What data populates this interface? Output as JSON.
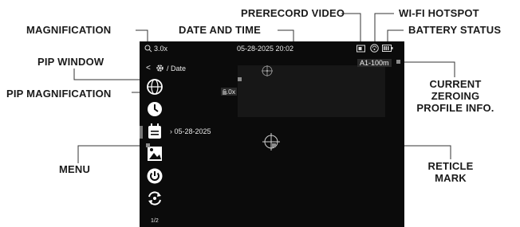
{
  "labels": {
    "magnification": "MAGNIFICATION",
    "date_and_time": "DATE AND TIME",
    "prerecord_video": "PRERECORD VIDEO",
    "wifi_hotspot": "WI-FI HOTSPOT",
    "battery_status": "BATTERY STATUS",
    "pip_window": "PIP WINDOW",
    "pip_magnification": "PIP MAGNIFICATION",
    "current_zeroing_line1": "CURRENT",
    "current_zeroing_line2": "ZEROING",
    "current_zeroing_line3": "PROFILE INFO.",
    "menu": "MENU",
    "reticle_line1": "RETICLE",
    "reticle_line2": "MARK"
  },
  "screen": {
    "magnification": "3.0x",
    "datetime": "05-28-2025 20:02",
    "breadcrumb": "/ Date",
    "pip_magnification": "6.0x",
    "zeroing_profile": "A1-100m",
    "date_value": "› 05-28-2025",
    "page_indicator": "1/2"
  },
  "icons": [
    "search-icon",
    "prerecord-video-icon",
    "wifi-hotspot-icon",
    "battery-icon",
    "back-chevron-icon",
    "gear-icon",
    "globe-icon",
    "clock-icon",
    "calendar-icon",
    "photo-icon",
    "power-icon",
    "rotate-icon",
    "reticle-icon"
  ],
  "colors": {
    "screen_bg": "#0b0b0b",
    "label_text": "#1a1a1a",
    "leader_line": "#333333"
  }
}
